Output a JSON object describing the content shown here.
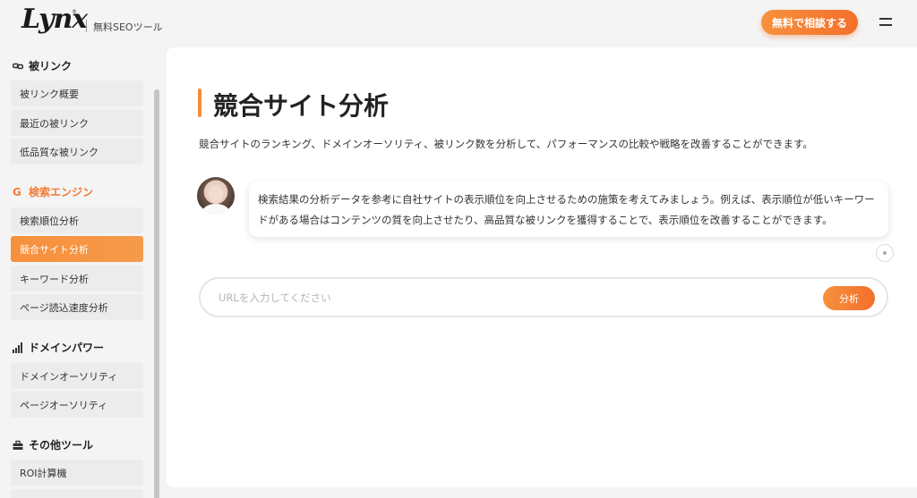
{
  "header": {
    "logo_text": "Lynx",
    "logo_sup": "®",
    "tagline": "無料SEOツール",
    "cta_label": "無料で相談する",
    "menu_icon": "hamburger-icon"
  },
  "sidebar": {
    "sections": [
      {
        "title": "被リンク",
        "icon": "link-icon",
        "items": [
          "被リンク概要",
          "最近の被リンク",
          "低品質な被リンク"
        ]
      },
      {
        "title": "検索エンジン",
        "icon": "google-g-icon",
        "items": [
          "検索順位分析",
          "競合サイト分析",
          "キーワード分析",
          "ページ読込速度分析"
        ]
      },
      {
        "title": "ドメインパワー",
        "icon": "signal-bars-icon",
        "items": [
          "ドメインオーソリティ",
          "ページオーソリティ"
        ]
      },
      {
        "title": "その他ツール",
        "icon": "toolbox-icon",
        "items": [
          "ROI計算機"
        ]
      }
    ],
    "active_item": "競合サイト分析"
  },
  "main": {
    "title": "競合サイト分析",
    "description": "競合サイトのランキング、ドメインオーソリティ、被リンク数を分析して、パフォーマンスの比較や戦略を改善することができます。",
    "chat_message": "検索結果の分析データを参考に自社サイトの表示順位を向上させるための施策を考えてみましょう。例えば、表示順位が低いキーワードがある場合はコンテンツの質を向上させたり、高品質な被リンクを獲得することで、表示順位を改善することができます。",
    "url_placeholder": "URLを入力してください",
    "url_value": "",
    "analyze_label": "分析"
  },
  "colors": {
    "accent": "#f48a3a",
    "background": "#f4f4f4",
    "panel": "#ffffff"
  }
}
